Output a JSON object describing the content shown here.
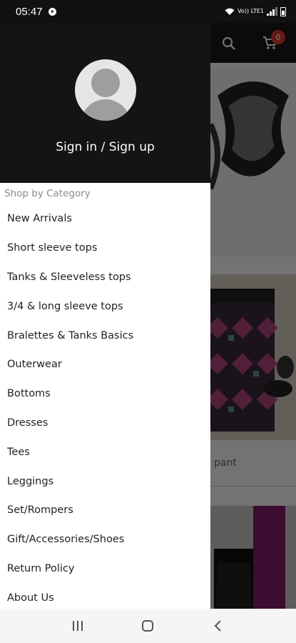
{
  "status_bar": {
    "time": "05:47",
    "network_label": "Vo)) LTE1"
  },
  "app": {
    "cart_count": "0",
    "product_label": "pant"
  },
  "drawer": {
    "sign_in_label": "Sign in / Sign up",
    "section_title": "Shop by Category",
    "items": [
      {
        "label": "New Arrivals"
      },
      {
        "label": "Short sleeve tops"
      },
      {
        "label": "Tanks & Sleeveless tops"
      },
      {
        "label": "3/4 & long sleeve tops"
      },
      {
        "label": "Bralettes & Tanks Basics"
      },
      {
        "label": "Outerwear"
      },
      {
        "label": "Bottoms"
      },
      {
        "label": "Dresses"
      },
      {
        "label": "Tees"
      },
      {
        "label": "Leggings"
      },
      {
        "label": "Set/Rompers"
      },
      {
        "label": "Gift/Accessories/Shoes"
      },
      {
        "label": "Return Policy"
      },
      {
        "label": "About Us"
      }
    ]
  },
  "navbar": {
    "icons": [
      "recent-apps-icon",
      "home-icon",
      "back-icon"
    ]
  },
  "colors": {
    "drawer_header": "#141414",
    "cart_badge": "#e53935"
  }
}
